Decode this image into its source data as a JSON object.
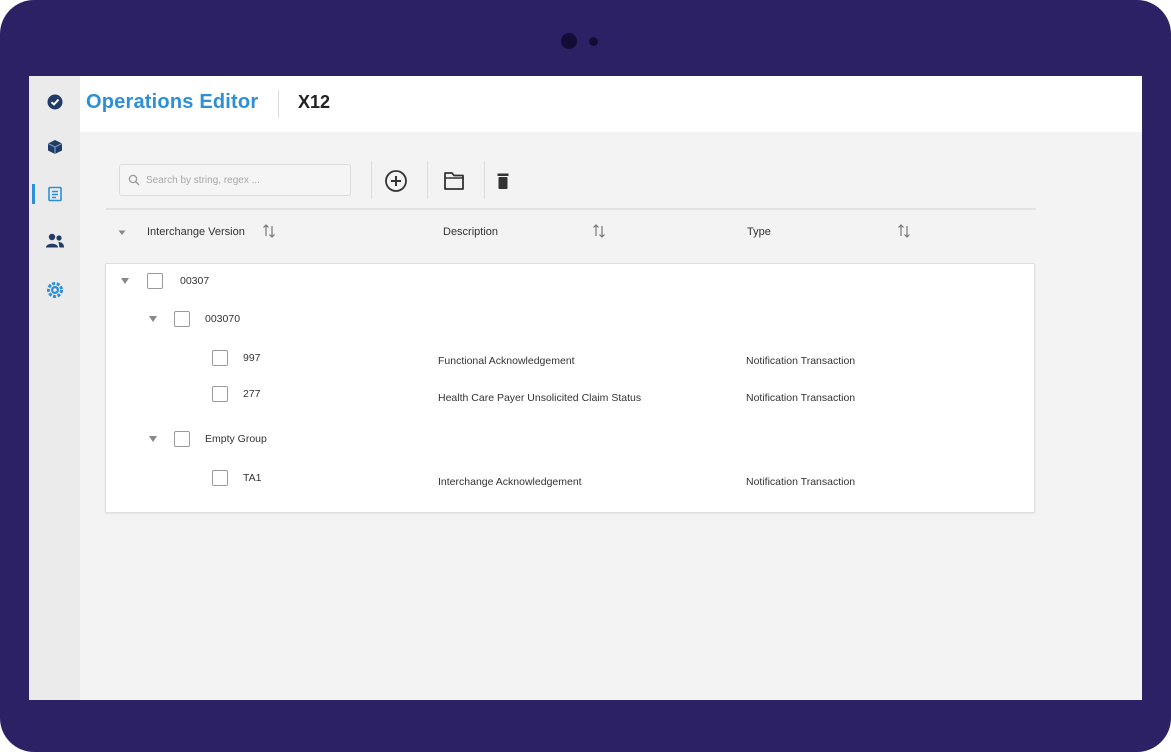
{
  "app": {
    "title": "Operations Editor",
    "subtitle": "X12"
  },
  "sidebar": {
    "items": [
      {
        "icon": "check-circle-icon",
        "active": false
      },
      {
        "icon": "cube-icon",
        "active": false
      },
      {
        "icon": "document-list-icon",
        "active": true
      },
      {
        "icon": "users-icon",
        "active": false
      },
      {
        "icon": "gear-icon",
        "active": false
      }
    ]
  },
  "toolbar": {
    "search_placeholder": "Search by string, regex ...",
    "buttons": [
      "add-circle-icon",
      "folder-open-icon",
      "trash-icon"
    ]
  },
  "table": {
    "columns": [
      "Interchange Version",
      "Description",
      "Type"
    ],
    "rows": [
      {
        "level": 0,
        "expanded": true,
        "label": "00307",
        "description": "",
        "type": ""
      },
      {
        "level": 1,
        "expanded": true,
        "label": "003070",
        "description": "",
        "type": ""
      },
      {
        "level": 2,
        "label": "997",
        "description": "Functional Acknowledgement",
        "type": "Notification Transaction"
      },
      {
        "level": 2,
        "label": "277",
        "description": "Health Care Payer Unsolicited Claim Status",
        "type": "Notification Transaction"
      },
      {
        "level": 1,
        "expanded": true,
        "label": "Empty Group",
        "description": "",
        "type": ""
      },
      {
        "level": 2,
        "label": "TA1",
        "description": "Interchange Acknowledgement",
        "type": "Notification Transaction"
      }
    ]
  },
  "colors": {
    "frame": "#2d2166",
    "accent": "#2d8fd6",
    "background": "#f3f3f3"
  }
}
